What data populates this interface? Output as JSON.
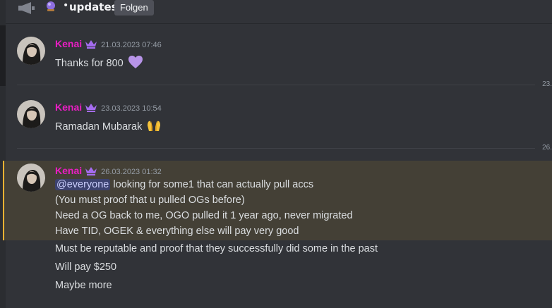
{
  "header": {
    "channel_separator": "•",
    "channel_name": "updates",
    "follow_label": "Folgen"
  },
  "dividers": [
    {
      "label": "23."
    },
    {
      "label": "26."
    }
  ],
  "messages": [
    {
      "author": "Kenai",
      "timestamp": "21.03.2023 07:46",
      "text": "Thanks for 800",
      "emoji": "purple-heart"
    },
    {
      "author": "Kenai",
      "timestamp": "23.03.2023 10:54",
      "text": "Ramadan Mubarak",
      "emoji": "raised-hands"
    },
    {
      "author": "Kenai",
      "timestamp": "26.03.2023 01:32",
      "mention": "@everyone",
      "lines": [
        " looking for some1 that can actually pull accs",
        "(You must proof that u pulled OGs before)",
        "Need a OG back to me, OGO pulled it 1 year ago, never migrated",
        "Have TID, OGEK & everything else will pay very good"
      ],
      "highlighted": true
    }
  ],
  "followups": [
    "Must be reputable and proof that they successfully did some in the past",
    "Will pay $250",
    "Maybe more"
  ],
  "colors": {
    "background": "#313338",
    "author": "#e91ec3",
    "crown": "#a56cf0",
    "highlight": "#444036",
    "highlight_bar": "#f0b232"
  }
}
